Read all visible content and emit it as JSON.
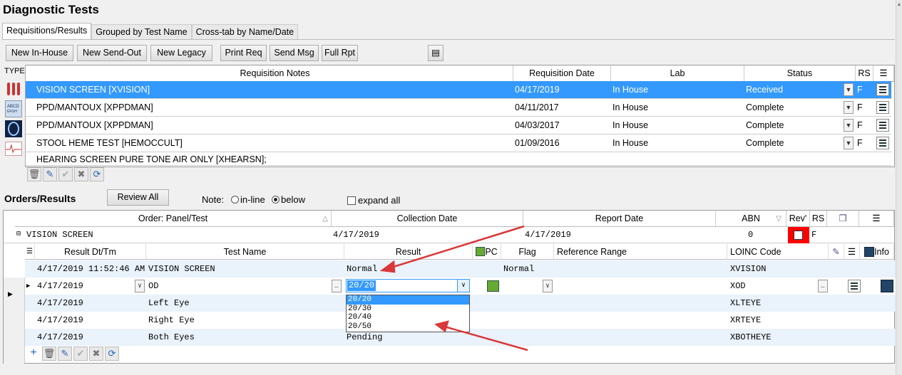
{
  "window": {
    "title": "Diagnostic Tests"
  },
  "tabs": [
    {
      "label": "Requisitions/Results",
      "active": true
    },
    {
      "label": "Grouped by Test Name",
      "active": false
    },
    {
      "label": "Cross-tab by Name/Date",
      "active": false
    }
  ],
  "toolbar": {
    "new_inhouse": "New In-House",
    "new_sendout": "New Send-Out",
    "new_legacy": "New Legacy",
    "print_req": "Print Req",
    "send_msg": "Send Msg",
    "full_rpt": "Full Rpt"
  },
  "requisitions": {
    "type_label": "TYPE",
    "columns": [
      "Requisition Notes",
      "Requisition Date",
      "Lab",
      "Status",
      "RS"
    ],
    "rows": [
      {
        "notes": "VISION SCREEN [XVISION]",
        "date": "04/17/2019",
        "lab": "In House",
        "status": "Received",
        "rs": "F",
        "selected": true
      },
      {
        "notes": "PPD/MANTOUX [XPPDMAN]",
        "date": "04/11/2017",
        "lab": "In House",
        "status": "Complete",
        "rs": "F",
        "selected": false
      },
      {
        "notes": "PPD/MANTOUX [XPPDMAN]",
        "date": "04/03/2017",
        "lab": "In House",
        "status": "Complete",
        "rs": "F",
        "selected": false
      },
      {
        "notes": "STOOL HEME TEST [HEMOCCULT]",
        "date": "01/09/2016",
        "lab": "In House",
        "status": "Complete",
        "rs": "F",
        "selected": false
      },
      {
        "notes": "HEARING SCREEN PURE TONE AIR ONLY [XHEARSN];",
        "date": "",
        "lab": "",
        "status": "",
        "rs": "",
        "selected": false
      }
    ]
  },
  "orders": {
    "title": "Orders/Results",
    "review_all": "Review All",
    "note_label": "Note:",
    "inline_label": "in-line",
    "below_label": "below",
    "expand_all": "expand all",
    "columns": [
      "Order: Panel/Test",
      "Collection Date",
      "Report Date",
      "ABN",
      "Rev'",
      "RS"
    ],
    "order_row": {
      "name": "VISION SCREEN",
      "collection": "4/17/2019",
      "report": "4/17/2019",
      "abn": "0",
      "rs": "F"
    },
    "result_columns": [
      "Result Dt/Tm",
      "Test Name",
      "Result",
      "PC",
      "Flag",
      "Reference Range",
      "LOINC Code",
      "Info"
    ],
    "results": [
      {
        "dt": "4/17/2019 11:52:46 AM",
        "test": "VISION SCREEN",
        "result": "Normal",
        "flag": "Normal",
        "loinc": "XVISION"
      },
      {
        "dt": "4/17/2019",
        "test": "OD",
        "result": "20/20",
        "flag": "",
        "loinc": "XOD"
      },
      {
        "dt": "4/17/2019",
        "test": "Left Eye",
        "result": "",
        "flag": "",
        "loinc": "XLTEYE"
      },
      {
        "dt": "4/17/2019",
        "test": "Right Eye",
        "result": "",
        "flag": "",
        "loinc": "XRTEYE"
      },
      {
        "dt": "4/17/2019",
        "test": "Both Eyes",
        "result": "Pending",
        "flag": "",
        "loinc": "XBOTHEYE"
      }
    ],
    "dropdown_options": [
      "20/20",
      "20/30",
      "20/40",
      "20/50"
    ]
  },
  "colors": {
    "selection": "#3399ff",
    "annotation_arrow": "#d9383a",
    "review_flag": "#ff0000"
  }
}
